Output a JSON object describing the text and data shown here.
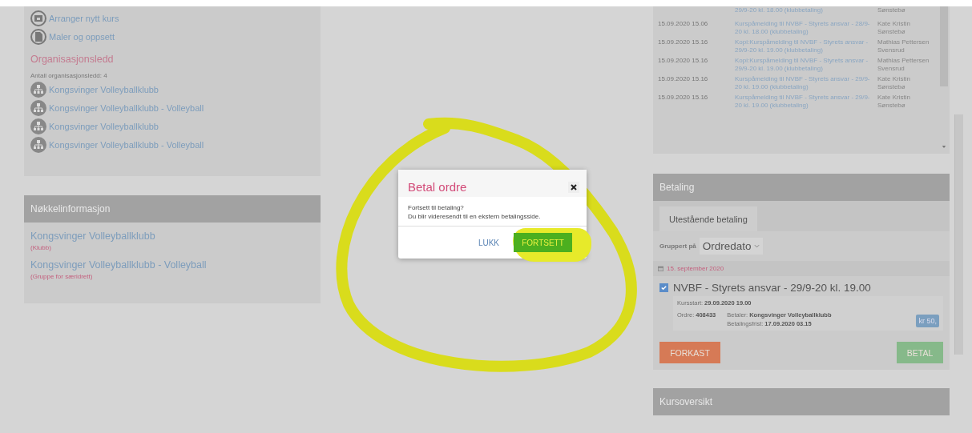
{
  "left_panel": {
    "links": [
      {
        "kind": "calendar",
        "label": "Arranger nytt kurs"
      },
      {
        "kind": "document",
        "label": "Maler og oppsett"
      }
    ],
    "section_title": "Organisasjonsledd",
    "count_text": "Antall organisasjonsledd: 4",
    "org_items": [
      "Kongsvinger Volleyballklubb",
      "Kongsvinger Volleyballklubb - Volleyball",
      "Kongsvinger Volleyballklubb",
      "Kongsvinger Volleyballklubb - Volleyball"
    ]
  },
  "key_info": {
    "title": "Nøkkelinformasjon",
    "items": [
      {
        "name": "Kongsvinger Volleyballklubb",
        "type": "(Klubb)"
      },
      {
        "name": "Kongsvinger Volleyballklubb - Volleyball",
        "type": "(Gruppe for særidrett)"
      }
    ]
  },
  "log": {
    "rows": [
      {
        "time": "",
        "message": "29/9-20 kl. 18.00 (klubbetaling)",
        "author": "Sønstebø"
      },
      {
        "time": "15.09.2020 15.06",
        "message": "Kurspåmelding til NVBF - Styrets ansvar - 28/9-20 kl. 18.00 (klubbetaling)",
        "author": "Kate Kristin Sønstebø"
      },
      {
        "time": "15.09.2020 15.16",
        "message": "Kopi:Kurspåmelding til NVBF - Styrets ansvar - 29/9-20 kl. 19.00 (klubbetaling)",
        "author": "Mathias Pettersen Svensrud"
      },
      {
        "time": "15.09.2020 15.16",
        "message": "Kopi:Kurspåmelding til NVBF - Styrets ansvar - 29/9-20 kl. 19.00 (klubbetaling)",
        "author": "Mathias Pettersen Svensrud"
      },
      {
        "time": "15.09.2020 15.16",
        "message": "Kurspåmelding til NVBF - Styrets ansvar - 29/9-20 kl. 19.00 (klubbetaling)",
        "author": "Kate Kristin Sønstebø"
      },
      {
        "time": "15.09.2020 15.16",
        "message": "Kurspåmelding til NVBF - Styrets ansvar - 29/9-20 kl. 19.00 (klubbetaling)",
        "author": "Kate Kristin Sønstebø"
      }
    ]
  },
  "payment": {
    "title": "Betaling",
    "tabs": [
      {
        "label": "Utestående betaling",
        "selected": true
      }
    ],
    "group_label": "Gruppert på",
    "group_value": "Ordredato",
    "date": "15. september 2020",
    "order": {
      "checked": true,
      "title": "NVBF - Styrets ansvar - 29/9-20 kl. 19.00",
      "course_start_label": "Kursstart:",
      "course_start": "29.09.2020 19.00",
      "order_label": "Ordre:",
      "order_no": "408433",
      "payer_label": "Betaler:",
      "payer": "Kongsvinger Volleyballklubb",
      "due_label": "Betalingsfrist:",
      "due": "17.09.2020 03.15",
      "amount": "kr 50,"
    },
    "buttons": [
      {
        "label": "FORKAST",
        "kind": "discard"
      },
      {
        "label": "BETAL",
        "kind": "pay"
      }
    ]
  },
  "course_overview": {
    "title": "Kursoversikt"
  },
  "dialog": {
    "title": "Betal ordre",
    "lines": [
      "Fortsett til betaling?",
      "Du blir videresendt til en ekstern betalingsside."
    ],
    "buttons": [
      {
        "label": "LUKK",
        "kind": "link"
      },
      {
        "label": "FORTSETT",
        "kind": "primary"
      }
    ]
  }
}
